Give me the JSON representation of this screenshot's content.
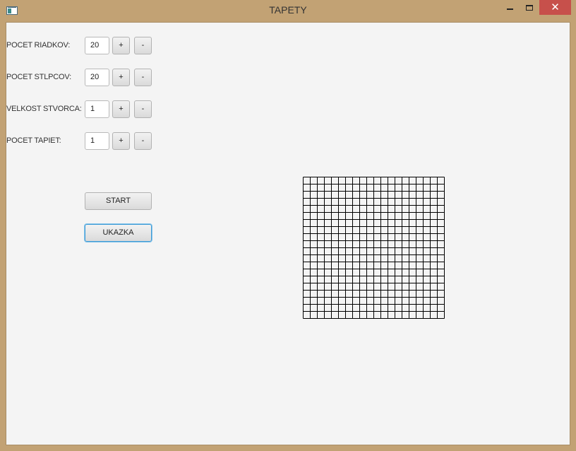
{
  "window": {
    "title": "TAPETY",
    "close_glyph": "✕"
  },
  "controls": [
    {
      "label": "POCET RIADKOV:",
      "value": "20",
      "plus": "+",
      "minus": "-"
    },
    {
      "label": "POCET STLPCOV:",
      "value": "20",
      "plus": "+",
      "minus": "-"
    },
    {
      "label": "VELKOST STVORCA:",
      "value": "1",
      "plus": "+",
      "minus": "-"
    },
    {
      "label": "POCET TAPIET:",
      "value": "1",
      "plus": "+",
      "minus": "-"
    }
  ],
  "buttons": {
    "start": "START",
    "ukazka": "UKAZKA"
  },
  "preview": {
    "rows": 20,
    "cols": 20,
    "line_color": "#000000"
  },
  "colors": {
    "window_frame": "#c2a274",
    "client_background": "#f4f4f4",
    "close_button": "#c7504b",
    "focus_ring": "#3c9ad6"
  }
}
